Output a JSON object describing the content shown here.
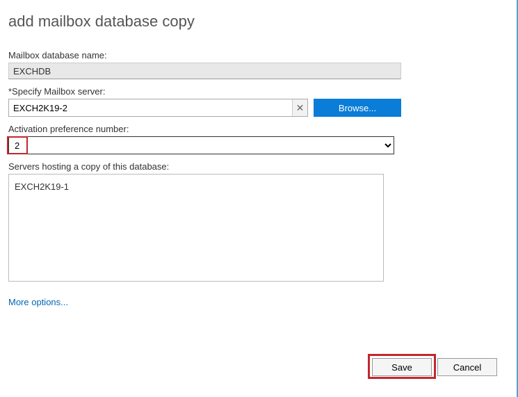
{
  "title": "add mailbox database copy",
  "fields": {
    "db_name_label": "Mailbox database name:",
    "db_name_value": "EXCHDB",
    "server_label": "*Specify Mailbox server:",
    "server_value": "EXCH2K19-2",
    "browse_label": "Browse...",
    "pref_label": "Activation preference number:",
    "pref_value": "2",
    "hosting_label": "Servers hosting a copy of this database:",
    "hosting_servers": [
      "EXCH2K19-1"
    ]
  },
  "more_options": "More options...",
  "buttons": {
    "save": "Save",
    "cancel": "Cancel"
  }
}
